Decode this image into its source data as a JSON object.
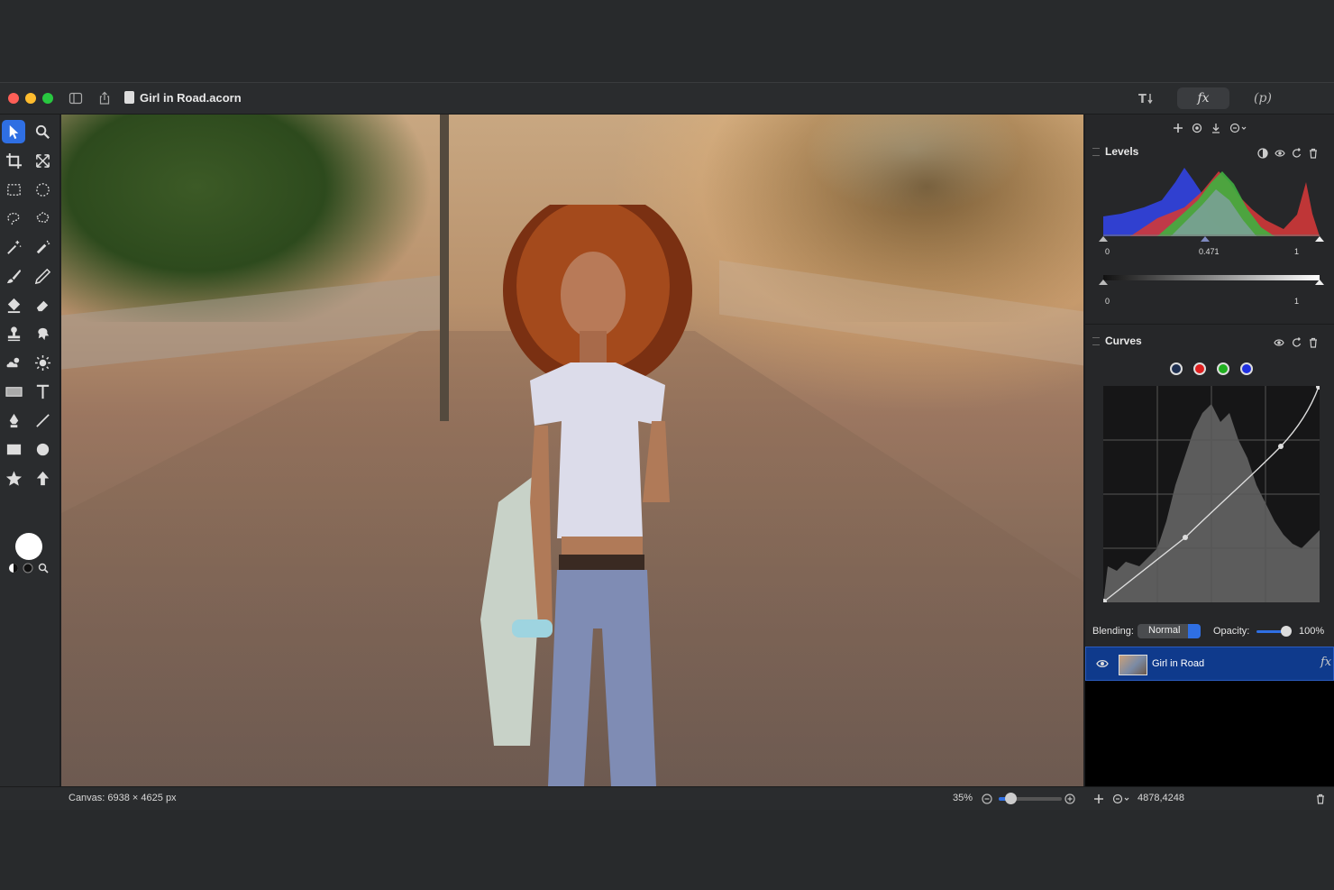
{
  "window": {
    "title": "Girl in Road.acorn",
    "toolbar_right": {
      "fx_label": "fx",
      "p_label": "p"
    }
  },
  "status": {
    "canvas_info": "Canvas: 6938 × 4625 px",
    "zoom": "35%",
    "zoom_fraction": 0.18,
    "cursor_coords": "4878,4248"
  },
  "levels": {
    "title": "Levels",
    "input_black": "0",
    "input_gamma": "0.471",
    "input_white": "1",
    "output_black": "0",
    "output_white": "1"
  },
  "curves": {
    "title": "Curves",
    "channels": [
      {
        "name": "rgb",
        "color": "#2f6fe3"
      },
      {
        "name": "red",
        "color": "#e02020"
      },
      {
        "name": "green",
        "color": "#20b020"
      },
      {
        "name": "blue",
        "color": "#2030e0"
      }
    ]
  },
  "layer_controls": {
    "blending_label": "Blending:",
    "blending_value": "Normal",
    "opacity_label": "Opacity:",
    "opacity_value": "100%"
  },
  "layers": [
    {
      "name": "Girl in Road",
      "visible": true,
      "fx": "fx"
    }
  ],
  "tools": [
    "move-tool",
    "zoom-tool",
    "crop-tool",
    "transform-tool",
    "rect-select-tool",
    "ellipse-select-tool",
    "lasso-tool",
    "polygon-lasso-tool",
    "magic-wand-tool",
    "instant-alpha-tool",
    "brush-tool",
    "pencil-tool",
    "paint-bucket-tool",
    "eraser-tool",
    "clone-tool",
    "smudge-tool",
    "burn-tool",
    "dodge-tool",
    "shape-tool",
    "text-tool",
    "pen-tool",
    "line-tool",
    "rectangle-tool",
    "oval-tool",
    "star-tool",
    "arrow-tool"
  ],
  "colors": {
    "accent": "#2f6fe3",
    "selected_layer": "#0f3a8c"
  }
}
